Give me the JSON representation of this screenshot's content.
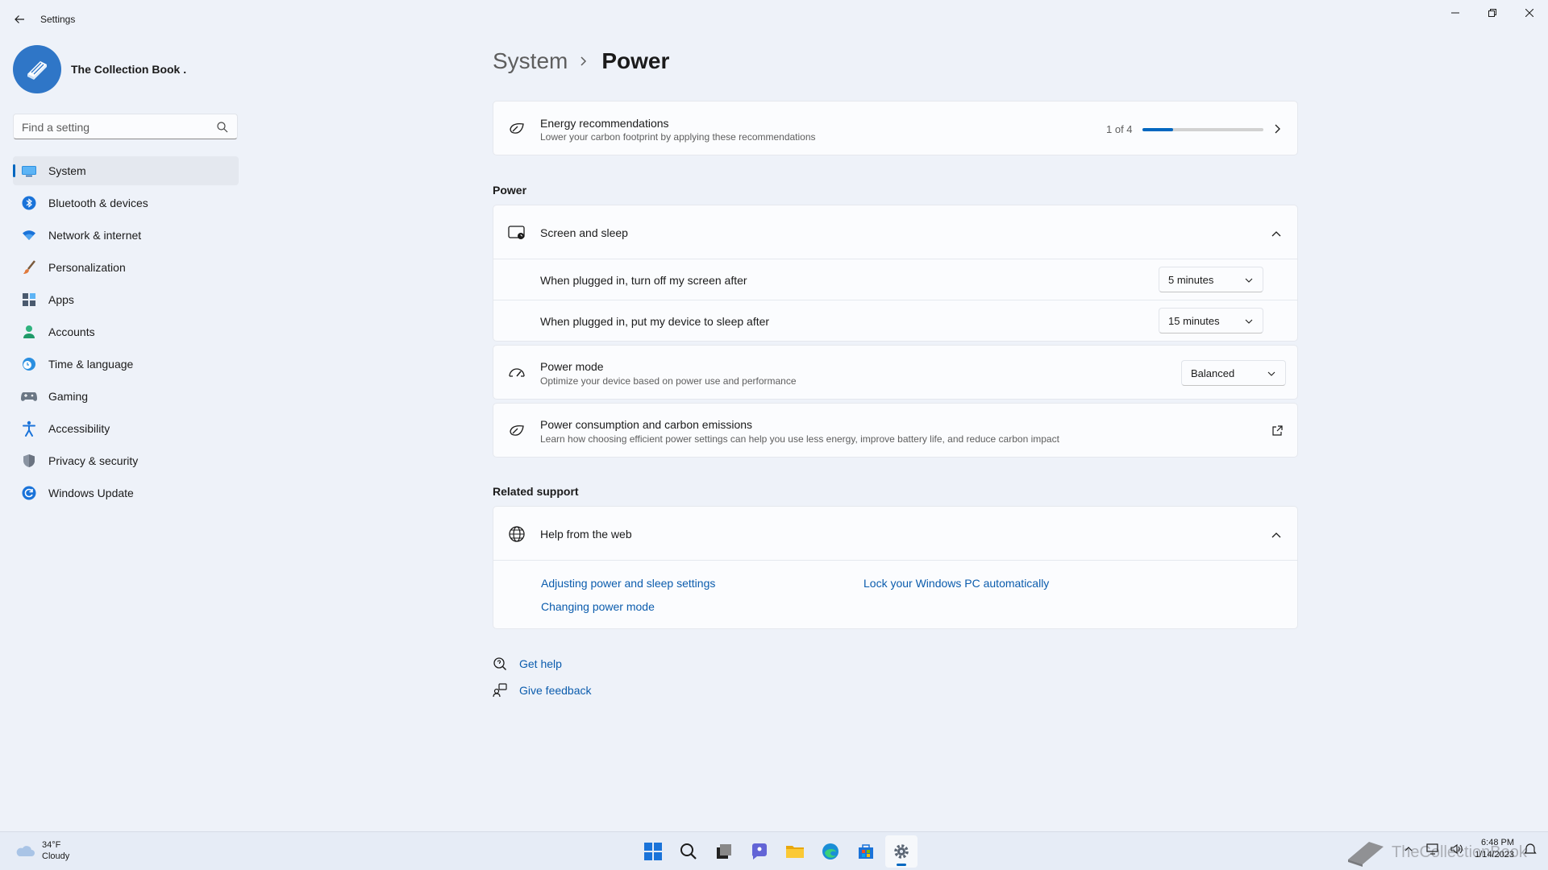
{
  "window": {
    "title": "Settings"
  },
  "profile": {
    "name": "The Collection Book ."
  },
  "search": {
    "placeholder": "Find a setting"
  },
  "sidebar": {
    "items": [
      {
        "label": "System",
        "icon": "monitor-icon",
        "active": true
      },
      {
        "label": "Bluetooth & devices",
        "icon": "bluetooth-icon"
      },
      {
        "label": "Network & internet",
        "icon": "wifi-icon"
      },
      {
        "label": "Personalization",
        "icon": "brush-icon"
      },
      {
        "label": "Apps",
        "icon": "apps-icon"
      },
      {
        "label": "Accounts",
        "icon": "person-icon"
      },
      {
        "label": "Time & language",
        "icon": "globe-clock-icon"
      },
      {
        "label": "Gaming",
        "icon": "gamepad-icon"
      },
      {
        "label": "Accessibility",
        "icon": "accessibility-icon"
      },
      {
        "label": "Privacy & security",
        "icon": "shield-icon"
      },
      {
        "label": "Windows Update",
        "icon": "refresh-icon"
      }
    ]
  },
  "breadcrumb": {
    "parent": "System",
    "current": "Power"
  },
  "energy": {
    "title": "Energy recommendations",
    "subtitle": "Lower your carbon footprint by applying these recommendations",
    "progress_text": "1 of 4",
    "progress_fraction": 0.25
  },
  "power_section": {
    "heading": "Power",
    "screen_sleep": {
      "title": "Screen and sleep",
      "rows": [
        {
          "label": "When plugged in, turn off my screen after",
          "value": "5 minutes"
        },
        {
          "label": "When plugged in, put my device to sleep after",
          "value": "15 minutes"
        }
      ]
    },
    "power_mode": {
      "title": "Power mode",
      "subtitle": "Optimize your device based on power use and performance",
      "value": "Balanced"
    },
    "consumption": {
      "title": "Power consumption and carbon emissions",
      "subtitle": "Learn how choosing efficient power settings can help you use less energy, improve battery life, and reduce carbon impact"
    }
  },
  "related": {
    "heading": "Related support",
    "help_web": {
      "title": "Help from the web",
      "links": [
        "Adjusting power and sleep settings",
        "Changing power mode",
        "Lock your Windows PC automatically"
      ]
    }
  },
  "footer": {
    "get_help": "Get help",
    "give_feedback": "Give feedback"
  },
  "taskbar": {
    "weather_temp": "34°F",
    "weather_desc": "Cloudy",
    "time": "6:48 PM",
    "date": "1/14/2023",
    "watermark": "TheCollectionBook"
  },
  "colors": {
    "accent": "#0067c0",
    "link": "#0b5cad",
    "background": "#eef2f9"
  }
}
